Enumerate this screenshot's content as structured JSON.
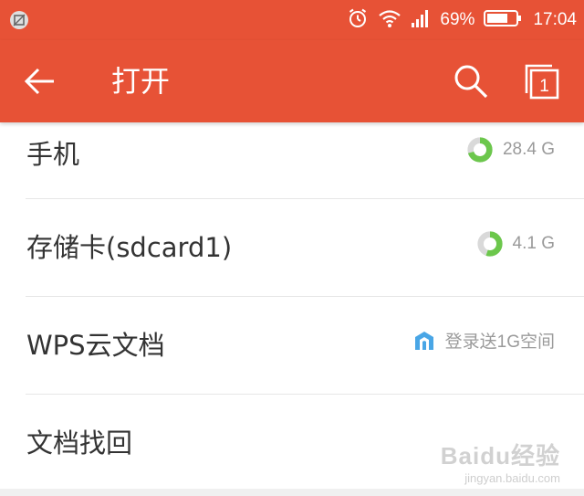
{
  "status_bar": {
    "battery_percent": "69%",
    "time": "17:04",
    "icons": [
      "screenshot-icon",
      "alarm-icon",
      "wifi-icon",
      "signal-icon",
      "battery-icon"
    ]
  },
  "app_bar": {
    "title": "打开",
    "pages_count": "1",
    "icons": [
      "back-arrow-icon",
      "search-icon",
      "pages-icon"
    ],
    "color": "#e75236"
  },
  "locations": [
    {
      "label": "手机",
      "meta": "28.4 G",
      "meta_type": "storage",
      "used_fraction": 0.7
    },
    {
      "label": "存储卡(sdcard1)",
      "meta": "4.1 G",
      "meta_type": "storage",
      "used_fraction": 0.55
    },
    {
      "label": "WPS云文档",
      "meta": "登录送1G空间",
      "meta_type": "cloud"
    },
    {
      "label": "文档找回",
      "meta": "",
      "meta_type": "none"
    }
  ],
  "colors": {
    "storage_used": "#6cc74c",
    "storage_free": "#d9d9d9",
    "cloud_icon": "#49a6e6"
  },
  "watermark": {
    "main": "Baidu经验",
    "sub": "jingyan.baidu.com"
  }
}
